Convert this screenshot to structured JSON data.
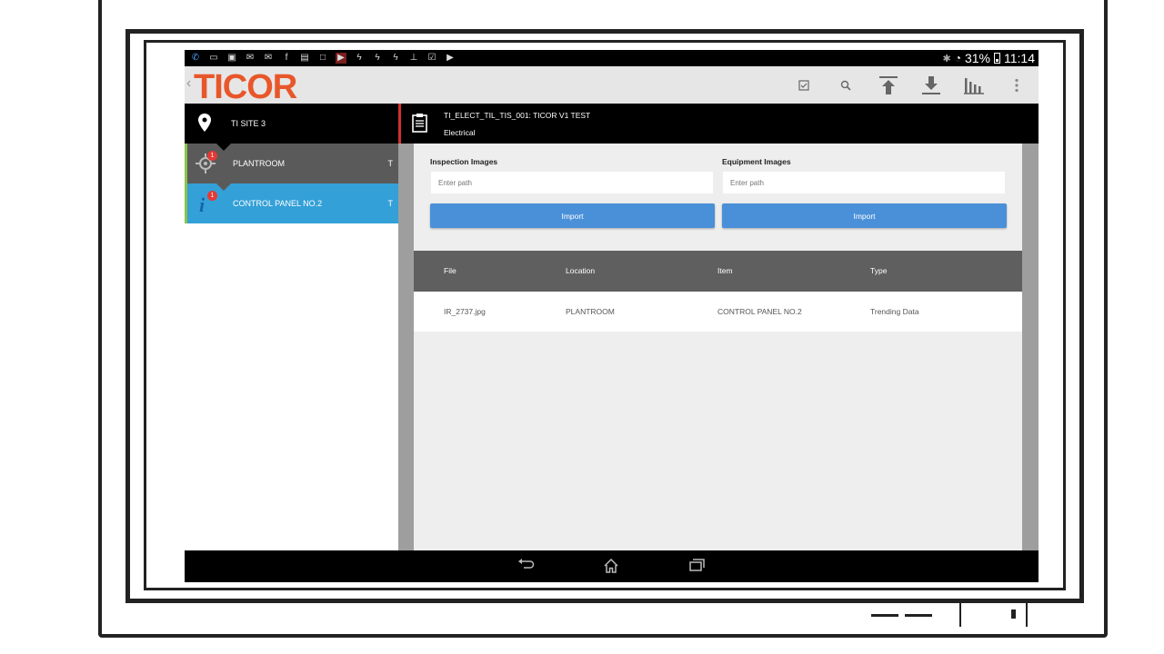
{
  "status_bar": {
    "left_icons": [
      "phone-icon",
      "chat-icon",
      "image-icon",
      "mail-icon",
      "gmail-icon",
      "facebook-icon",
      "calendar-icon",
      "square-icon",
      "video-icon",
      "signal-a-icon",
      "signal-b-icon",
      "signal-c-icon",
      "usb-icon",
      "check-icon",
      "play-icon"
    ],
    "battery": "31%",
    "time": "11:14"
  },
  "app_bar": {
    "logo": "TICOR",
    "actions": [
      "checklist-icon",
      "search-icon",
      "upload-icon",
      "download-icon",
      "bar-chart-icon",
      "overflow-menu-icon"
    ]
  },
  "sidebar": {
    "site_name": "TI SITE 3",
    "items": [
      {
        "label": "PLANTROOM",
        "letter": "T",
        "badge": "1",
        "color": "#5a5a5a"
      },
      {
        "label": "CONTROL PANEL NO.2",
        "letter": "T",
        "badge": "1",
        "color": "#34a0d8"
      }
    ]
  },
  "detail_header": {
    "title": "TI_ELECT_TIL_TIS_001: TICOR V1 TEST",
    "subtitle": "Electrical"
  },
  "import_panel": {
    "inspection": {
      "label": "Inspection Images",
      "placeholder": "Enter path",
      "button": "Import"
    },
    "equipment": {
      "label": "Equipment Images",
      "placeholder": "Enter path",
      "button": "Import"
    }
  },
  "table": {
    "columns": [
      "File",
      "Location",
      "Item",
      "Type"
    ],
    "rows": [
      [
        "IR_2737.jpg",
        "PLANTROOM",
        "CONTROL PANEL NO.2",
        "Trending Data"
      ]
    ]
  },
  "colors": {
    "accent": "#4a90d9",
    "brand": "#e8572a",
    "selected_item": "#34a0d8",
    "header_red": "#d32f2f"
  }
}
